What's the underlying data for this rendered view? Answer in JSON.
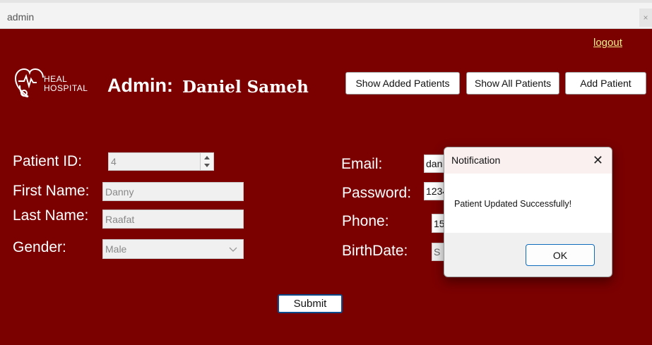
{
  "window": {
    "title": "admin",
    "close_glyph": "×"
  },
  "header": {
    "logout": "logout",
    "logo": {
      "line1": "HEAL",
      "line2": "HOSPITAL"
    },
    "admin_label": "Admin:",
    "admin_name": "Daniel Sameh",
    "buttons": {
      "show_added": "Show Added Patients",
      "show_all": "Show All Patients",
      "add": "Add Patient"
    }
  },
  "form": {
    "patient_id": {
      "label": "Patient ID:",
      "value": "4"
    },
    "first_name": {
      "label": "First Name:",
      "value": "Danny"
    },
    "last_name": {
      "label": "Last Name:",
      "value": "Raafat"
    },
    "gender": {
      "label": "Gender:",
      "value": "Male"
    },
    "email": {
      "label": "Email:",
      "value": "dan"
    },
    "password": {
      "label": "Password:",
      "value": "1234"
    },
    "phone": {
      "label": "Phone:",
      "value": "15"
    },
    "birthdate": {
      "label": "BirthDate:",
      "value": "S"
    },
    "submit": "Submit"
  },
  "dialog": {
    "title": "Notification",
    "close_glyph": "✕",
    "message": "Patient Updated Successfully!",
    "ok": "OK"
  },
  "colors": {
    "background": "#7b0000",
    "logout_link": "#f0f08a",
    "dialog_accent": "#0f6cbd"
  },
  "icons": {
    "logo": "heart-stethoscope-icon",
    "spinner": "spinner-arrows-icon",
    "dropdown": "chevron-down-icon"
  }
}
